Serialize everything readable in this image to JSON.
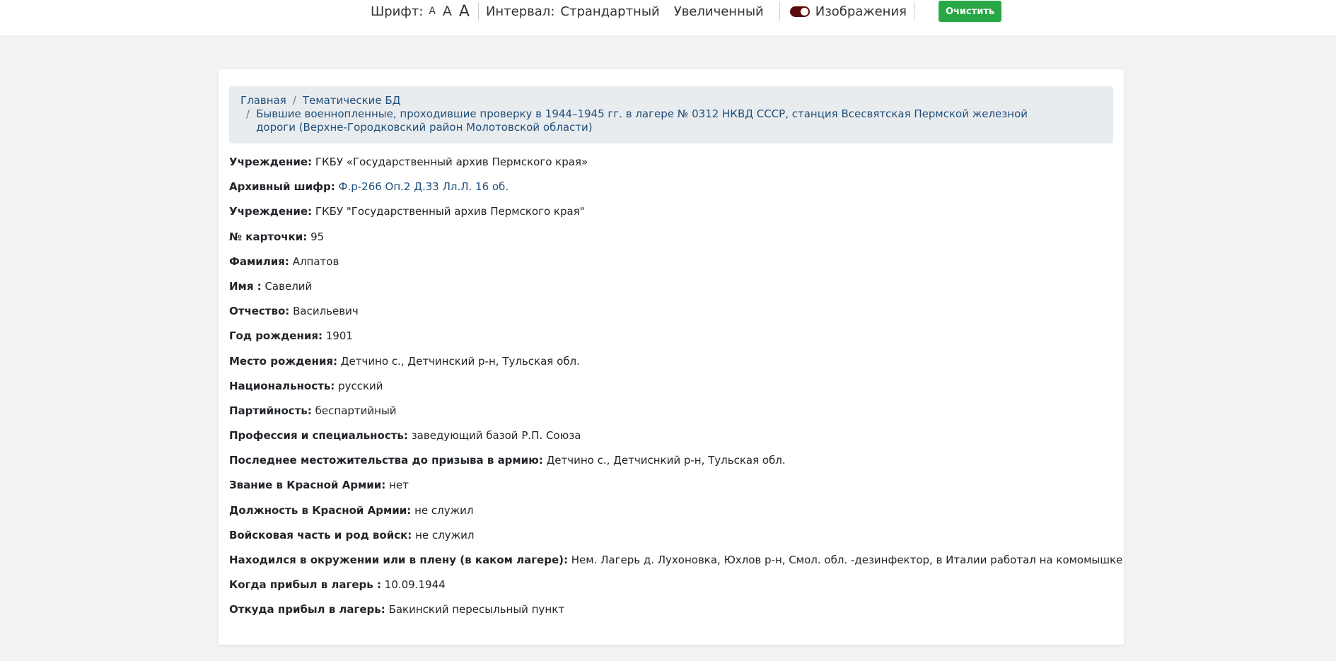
{
  "toolbar": {
    "font_label": "Шрифт:",
    "font_sizes": [
      "A",
      "A",
      "A"
    ],
    "interval_label": "Интервал:",
    "interval_standard": "Страндартный",
    "interval_increased": "Увеличенный",
    "images_label": "Изображения",
    "clear_button": "Очистить",
    "toggle_color": "#5a0a0a",
    "clear_color": "#28a745"
  },
  "breadcrumb": {
    "home": "Главная",
    "thematic": "Тематические БД",
    "current": "Бывшие военнопленные, проходившие проверку в 1944–1945 гг. в лагере № 0312 НКВД СССР, станция Всесвятская Пермской железной дороги (Верхне-Городковский район Молотовской области)",
    "separator": "/"
  },
  "fields": [
    {
      "label": "Учреждение:",
      "value": "ГКБУ «Государственный архив Пермского края»"
    },
    {
      "label": "Архивный шифр:",
      "value": "Ф.р-266 Оп.2 Д.33 Лл.Л. 16 об."
    },
    {
      "label": "Учреждение:",
      "value": "ГКБУ \"Государственный архив Пермского края\""
    },
    {
      "label": "№ карточки:",
      "value": "95"
    },
    {
      "label": "Фамилия:",
      "value": "Алпатов"
    },
    {
      "label": "Имя :",
      "value": "Савелий"
    },
    {
      "label": "Отчество:",
      "value": "Васильевич"
    },
    {
      "label": "Год рождения:",
      "value": "1901"
    },
    {
      "label": "Место рождения:",
      "value": "Детчино с., Детчинский р-н, Тульская обл."
    },
    {
      "label": "Национальность:",
      "value": "русский"
    },
    {
      "label": "Партийность:",
      "value": "беспартийный"
    },
    {
      "label": "Профессия и специальность:",
      "value": "заведующий базой Р.П. Союза"
    },
    {
      "label": "Последнее местожительства до призыва в армию:",
      "value": "Детчино с., Детчиснкий р-н, Тульская обл."
    },
    {
      "label": "Звание в Красной Армии:",
      "value": "нет"
    },
    {
      "label": "Должность в Красной Армии:",
      "value": "не служил"
    },
    {
      "label": "Войсковая часть и род войск:",
      "value": "не служил"
    },
    {
      "label": "Находился в окружении или в плену (в каком лагере):",
      "value": "Нем. Лагерь д. Лухоновка, Юхлов р-н, Смол. обл. -дезинфектор, в Италии работал на комомышке"
    },
    {
      "label": "Когда прибыл в лагерь :",
      "value": "10.09.1944"
    },
    {
      "label": "Откуда прибыл в лагерь:",
      "value": "Бакинский пересыльный пункт"
    }
  ]
}
